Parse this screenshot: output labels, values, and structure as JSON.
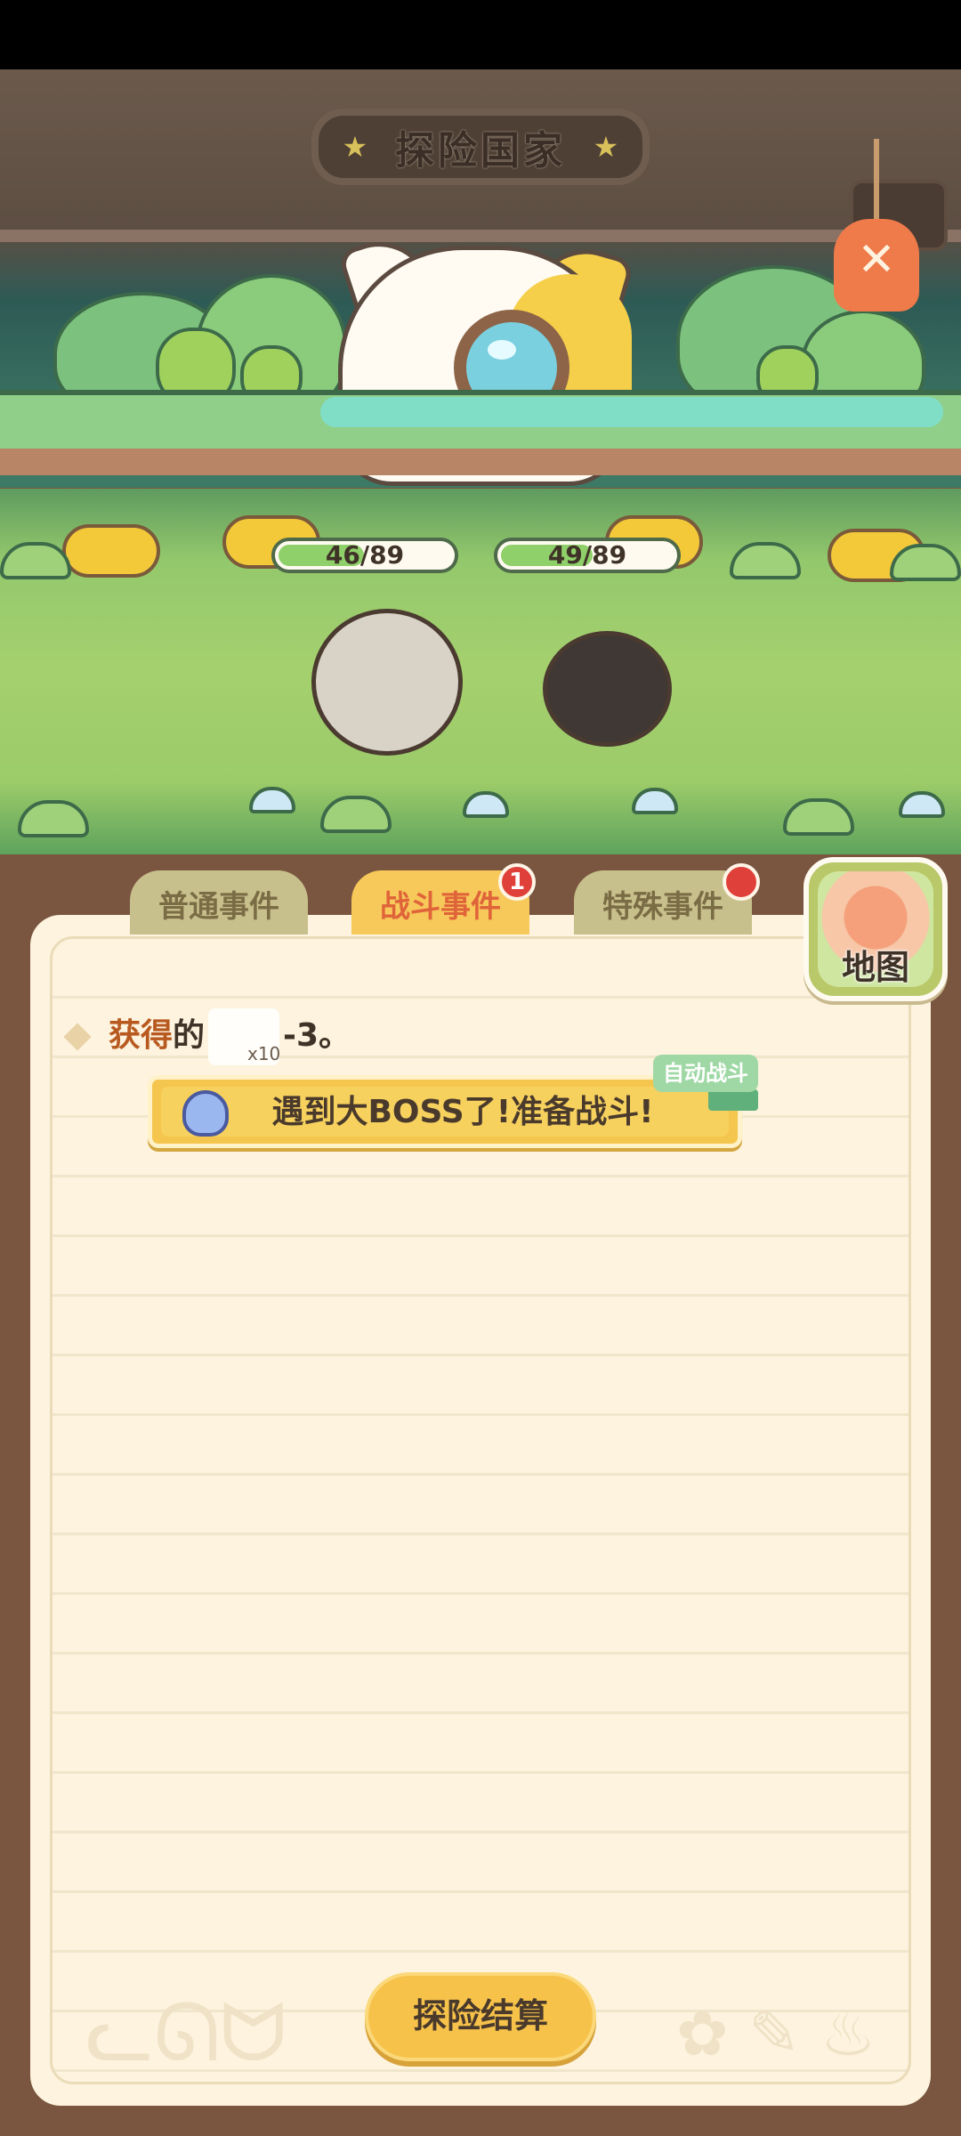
{
  "header": {
    "title": "探险国家"
  },
  "battle": {
    "ally_hp": {
      "text": "46/89",
      "current": 46,
      "max": 89
    },
    "enemy_hp": {
      "text": "49/89",
      "current": 49,
      "max": 89
    }
  },
  "tabs": [
    {
      "label": "普通事件",
      "badge": ""
    },
    {
      "label": "战斗事件",
      "badge": "1"
    },
    {
      "label": "特殊事件",
      "badge": ""
    }
  ],
  "map_button": {
    "label": "地图"
  },
  "log": {
    "line_prefix": "获得",
    "line_particle": "的",
    "line_suffix": "-3。",
    "item_qty": "x10"
  },
  "banner": {
    "text": "遇到大BOSS了!准备战斗!",
    "auto_battle_label": "自动战斗"
  },
  "footer": {
    "settle_label": "探险结算"
  },
  "colors": {
    "accent": "#f7c24a",
    "battle_tab_text": "#e0643a",
    "badge": "#e0403a",
    "hp_fill": "#8fd06a",
    "panel": "#fdf3de",
    "frame": "#7a5640"
  }
}
